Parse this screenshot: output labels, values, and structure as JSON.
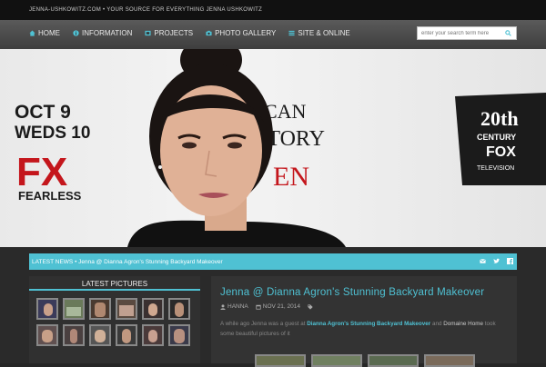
{
  "site": {
    "tagline": "JENNA-USHKOWITZ.COM • YOUR SOURCE FOR EVERYTHING JENNA USHKOWITZ"
  },
  "nav": {
    "items": [
      {
        "label": "HOME",
        "icon": "home-icon"
      },
      {
        "label": "INFORMATION",
        "icon": "info-icon"
      },
      {
        "label": "PROJECTS",
        "icon": "film-icon"
      },
      {
        "label": "PHOTO GALLERY",
        "icon": "camera-icon"
      },
      {
        "label": "SITE & ONLINE",
        "icon": "list-icon"
      }
    ]
  },
  "search": {
    "placeholder": "enter your search term here"
  },
  "hero": {
    "left_text": [
      "OCT 9",
      "WEDS 10"
    ],
    "left_logo": "FX",
    "left_sub": "FEARLESS",
    "center_text": [
      "RICAN",
      "STORY",
      "EN"
    ],
    "right_logo": [
      "20th",
      "CENTURY",
      "FOX",
      "TELEVISION"
    ]
  },
  "news": {
    "label": "LATEST NEWS • Jenna @ Dianna Agron's Stunning Backyard Makeover"
  },
  "sidebar": {
    "title": "LATEST PICTURES"
  },
  "post": {
    "title": "Jenna @ Dianna Agron's Stunning Backyard Makeover",
    "author": "HANNA",
    "date": "NOV 21, 2014",
    "excerpt_pre": "A while ago Jenna was a guest at ",
    "excerpt_link": "Dianna Agron's Stunning Backyard Makeover",
    "excerpt_mid": " and ",
    "excerpt_brand": "Domaine Home",
    "excerpt_post": " took some beautiful pictures of it"
  },
  "colors": {
    "accent": "#4fc1d3",
    "fx_red": "#c4161c"
  }
}
